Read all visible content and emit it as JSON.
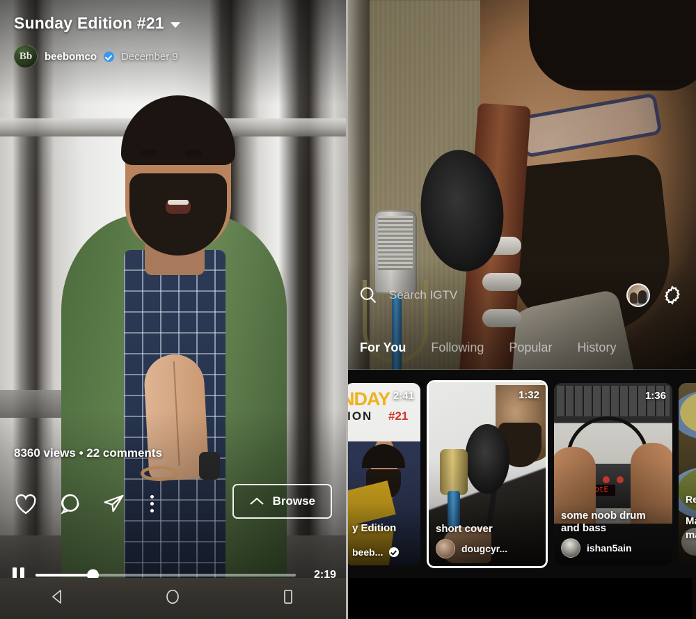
{
  "left_player": {
    "title": "Sunday Edition #21",
    "caret_icon": "chevron-down-icon",
    "avatar_initials": "Bb",
    "username": "beebomco",
    "verified_icon": "verified-badge-icon",
    "date": "December 9",
    "stats": "8360 views • 22 comments",
    "actions": {
      "like_icon": "heart-icon",
      "comment_icon": "comment-bubble-icon",
      "share_icon": "paper-plane-icon",
      "more_icon": "more-options-icon"
    },
    "browse_label": "Browse",
    "browse_caret_icon": "chevron-up-icon",
    "playback": {
      "pause_icon": "pause-icon",
      "progress_percent": 22,
      "duration": "2:19"
    }
  },
  "right_browse": {
    "search": {
      "icon": "search-icon",
      "placeholder": "Search IGTV"
    },
    "profile_icon": "profile-avatar-icon",
    "settings_icon": "gear-icon",
    "tabs": [
      {
        "label": "For You",
        "active": true
      },
      {
        "label": "Following",
        "active": false
      },
      {
        "label": "Popular",
        "active": false
      },
      {
        "label": "History",
        "active": false
      }
    ],
    "cards": [
      {
        "title": "y Edition",
        "username": "beeb...",
        "duration": "2:41",
        "verified": true,
        "thumb_overlay_text": "NDAY",
        "thumb_overlay_text2": "ITION",
        "thumb_overlay_badge": "#21"
      },
      {
        "title": "short cover",
        "username": "dougcyr...",
        "duration": "1:32",
        "verified": false
      },
      {
        "title": "some noob drum and bass",
        "username": "ishan5ain",
        "duration": "1:36",
        "verified": false,
        "led_text": "notE"
      },
      {
        "title_line1": "Re",
        "title_line2": "Ma",
        "title_line3": "ma",
        "username": "",
        "duration": ""
      }
    ]
  },
  "navbars": {
    "back_icon": "back-triangle-icon",
    "home_icon": "home-circle-icon",
    "recents_icon": "recents-square-icon"
  },
  "colors": {
    "accent_blue": "#3897f0",
    "card_bg": "#0b0b0b",
    "active_tab": "#ffffff"
  }
}
